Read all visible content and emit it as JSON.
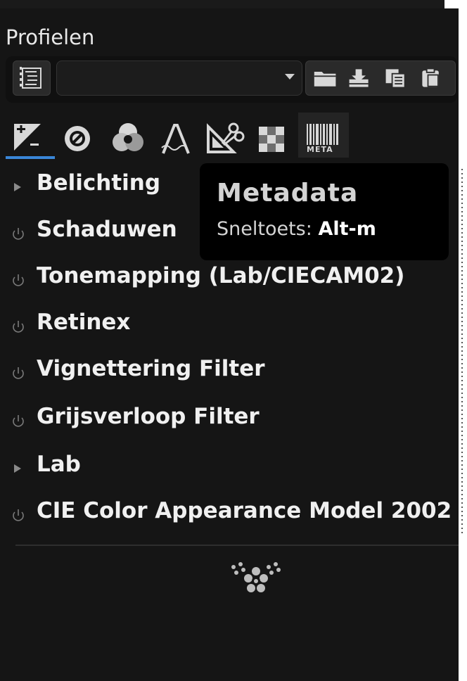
{
  "profiles": {
    "title": "Profielen",
    "combo_value": ""
  },
  "tooltip": {
    "title": "Metadata",
    "shortcut_label": "Sneltoets:",
    "shortcut_key": "Alt-m"
  },
  "tabs": [
    {
      "name": "exposure",
      "active": true
    },
    {
      "name": "detail"
    },
    {
      "name": "color"
    },
    {
      "name": "advanced"
    },
    {
      "name": "transform"
    },
    {
      "name": "raw"
    },
    {
      "name": "metadata",
      "label": "META"
    }
  ],
  "items": [
    {
      "label": "Belichting",
      "icon": "expander-arrow-icon"
    },
    {
      "label": "Schaduwen",
      "icon": "power-icon"
    },
    {
      "label": "Tonemapping (Lab/CIECAM02)",
      "icon": "power-icon"
    },
    {
      "label": "Retinex",
      "icon": "power-icon"
    },
    {
      "label": "Vignettering Filter",
      "icon": "power-icon"
    },
    {
      "label": "Grijsverloop Filter",
      "icon": "power-icon"
    },
    {
      "label": "Lab",
      "icon": "expander-arrow-icon"
    },
    {
      "label": "CIE Color Appearance Model 2002",
      "icon": "power-icon"
    }
  ],
  "colors": {
    "background": "#151515",
    "active_tab_underline": "#3a86d8",
    "tooltip_bg": "#000000"
  }
}
